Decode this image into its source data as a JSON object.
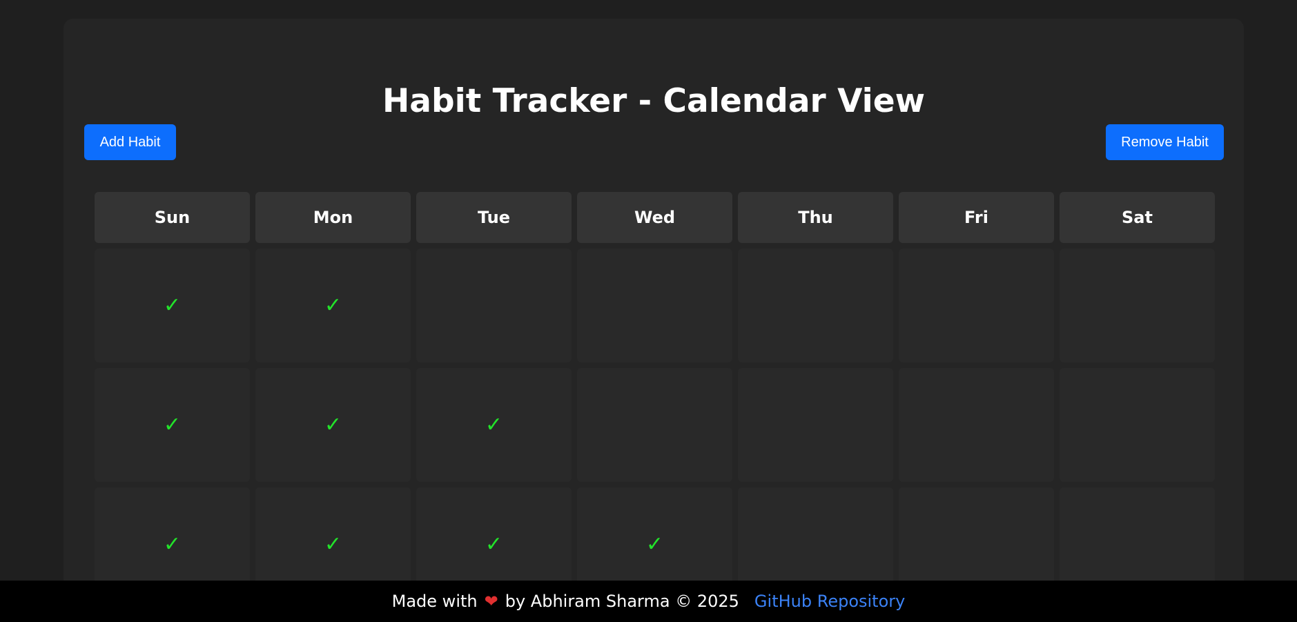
{
  "page": {
    "title": "Habit Tracker - Calendar View"
  },
  "toolbar": {
    "add_label": "Add Habit",
    "remove_label": "Remove Habit"
  },
  "calendar": {
    "days": [
      "Sun",
      "Mon",
      "Tue",
      "Wed",
      "Thu",
      "Fri",
      "Sat"
    ],
    "check_glyph": "✓",
    "weeks": [
      [
        true,
        true,
        false,
        false,
        false,
        false,
        false
      ],
      [
        true,
        true,
        true,
        false,
        false,
        false,
        false
      ],
      [
        true,
        true,
        true,
        true,
        false,
        false,
        false
      ]
    ]
  },
  "footer": {
    "made_with": "Made with",
    "heart": "❤",
    "byline": "by Abhiram Sharma © 2025",
    "link_label": "GitHub Repository"
  },
  "colors": {
    "accent": "#0d6efd",
    "check": "#22e32a",
    "link": "#3b82f6",
    "heart": "#e03030",
    "background": "#1f1f1f",
    "card": "#252525"
  },
  "icons": {
    "check": "check-icon",
    "heart": "heart-icon"
  }
}
